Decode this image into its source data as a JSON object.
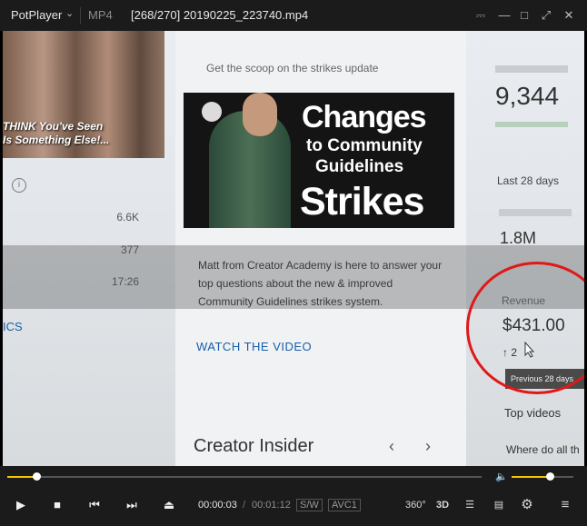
{
  "titlebar": {
    "app_name": "PotPlayer",
    "format": "MP4",
    "file_title": "[268/270] 20190225_223740.mp4",
    "icons": [
      "pin-icon",
      "minimize-icon",
      "maximize-icon",
      "fullscreen-icon",
      "close-icon"
    ]
  },
  "video": {
    "left_panel": {
      "thumb_caption_1": "THINK You've Seen",
      "thumb_caption_2": "Is Something Else!...",
      "values": [
        "6.6K",
        "377",
        "17:26"
      ],
      "cut_label": "ICS"
    },
    "card": {
      "scoop": "Get the scoop on the strikes update",
      "thumb_title_1": "Changes",
      "thumb_title_2": "to Community",
      "thumb_title_3": "Guidelines",
      "thumb_title_4": "Strikes",
      "description": "Matt from Creator Academy is here to answer your top questions about the new & improved Community Guidelines strikes system.",
      "cta": "WATCH THE VIDEO",
      "insider": "Creator Insider"
    },
    "right_panel": {
      "subs_value": "9,344",
      "last28": "Last 28 days",
      "watch_time_value": "1.8M",
      "revenue_label": "Revenue",
      "revenue_value": "$431.00",
      "revenue_delta": "↑ 2",
      "tooltip": "Previous 28 days",
      "top_videos": "Top videos",
      "where": "Where do all th"
    },
    "annotation_color": "#e01818"
  },
  "player": {
    "time_current": "00:00:03",
    "time_separator": "/",
    "time_total": "00:01:12",
    "tag_sw": "S/W",
    "tag_codec": "AVC1",
    "btn_360": "360°",
    "btn_3d": "3D",
    "seek_progress": 0.06,
    "volume_level": 0.62,
    "accent_color": "#f2c400"
  }
}
